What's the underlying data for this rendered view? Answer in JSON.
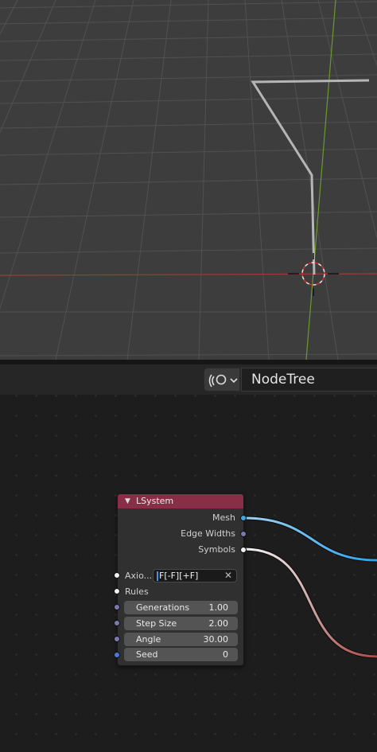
{
  "header": {
    "node_tree_name": "NodeTree",
    "tree_type_icon": "geometry-nodes-icon",
    "dropdown_icon": "chevron-down-icon"
  },
  "node": {
    "title": "LSystem",
    "header_color": "#8a2d46",
    "outputs": [
      "Mesh",
      "Edge Widths",
      "Symbols"
    ],
    "axiom_label": "Axio...",
    "axiom_value": "F[-F][+F]",
    "rules_label": "Rules",
    "fields": [
      {
        "label": "Generations",
        "value": "1.00"
      },
      {
        "label": "Step Size",
        "value": "2.00"
      },
      {
        "label": "Angle",
        "value": "30.00"
      },
      {
        "label": "Seed",
        "value": "0"
      }
    ]
  },
  "colors": {
    "mesh_socket": "#3fa7e6",
    "edge_widths_socket": "#7a7ab0",
    "symbols_socket": "#f0f0f0",
    "float_socket": "#7a7ab0",
    "int_socket": "#4a7ad8",
    "x_axis": "#a03a3a",
    "y_axis": "#6a9a2a"
  }
}
